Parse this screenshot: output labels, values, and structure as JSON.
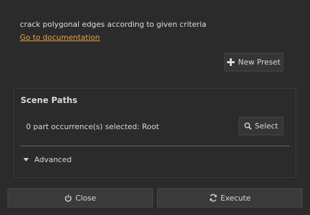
{
  "description": "crack polygonal edges according to given criteria",
  "documentation_link": "Go to documentation",
  "preset_button": {
    "label": "New Preset",
    "icon": "plus-icon"
  },
  "scene_paths": {
    "title": "Scene Paths",
    "selection_text": "0 part occurrence(s) selected: Root",
    "select_button": {
      "label": "Select",
      "icon": "search-icon"
    }
  },
  "advanced": {
    "label": "Advanced",
    "icon": "triangle-down-icon",
    "expanded": false
  },
  "footer": {
    "close_button": {
      "label": "Close",
      "icon": "power-icon"
    },
    "execute_button": {
      "label": "Execute",
      "icon": "refresh-icon"
    }
  },
  "colors": {
    "background": "#2b2b2b",
    "link": "#e8a33d",
    "text": "#d9d9d9"
  }
}
